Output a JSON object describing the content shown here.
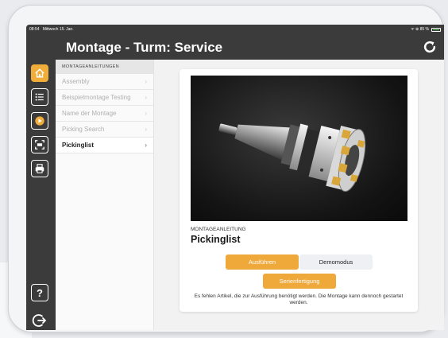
{
  "statusbar": {
    "time": "08:54",
    "date": "Mittwoch 15. Jan.",
    "indicators": "ᯤ ⊕ 85 %"
  },
  "header": {
    "title": "Montage - Turm: Service"
  },
  "rail": {
    "items": [
      {
        "icon": "home-icon",
        "active": true
      },
      {
        "icon": "list-icon",
        "active": false
      },
      {
        "icon": "play-icon",
        "active": false
      },
      {
        "icon": "scan-icon",
        "active": false
      },
      {
        "icon": "print-icon",
        "active": false
      }
    ],
    "help_label": "?"
  },
  "list": {
    "header": "MONTAGEANLEITUNGEN",
    "items": [
      {
        "label": "Assembly",
        "selected": false
      },
      {
        "label": "Beispielmontage Testing",
        "selected": false
      },
      {
        "label": "Name der Montage",
        "selected": false
      },
      {
        "label": "Picking Search",
        "selected": false
      },
      {
        "label": "Pickinglist",
        "selected": true
      }
    ]
  },
  "card": {
    "overline": "MONTAGEANLEITUNG",
    "title": "Pickinglist",
    "buttons": {
      "run": "Ausführen",
      "demo": "Demomodus",
      "series": "Serienfertigung"
    },
    "warning": "Es fehlen Artikel, die zur Ausführung benötigt werden. Die Montage kann dennoch gestartet werden."
  },
  "colors": {
    "accent": "#efa83a",
    "header_bg": "#3b3b3b"
  }
}
